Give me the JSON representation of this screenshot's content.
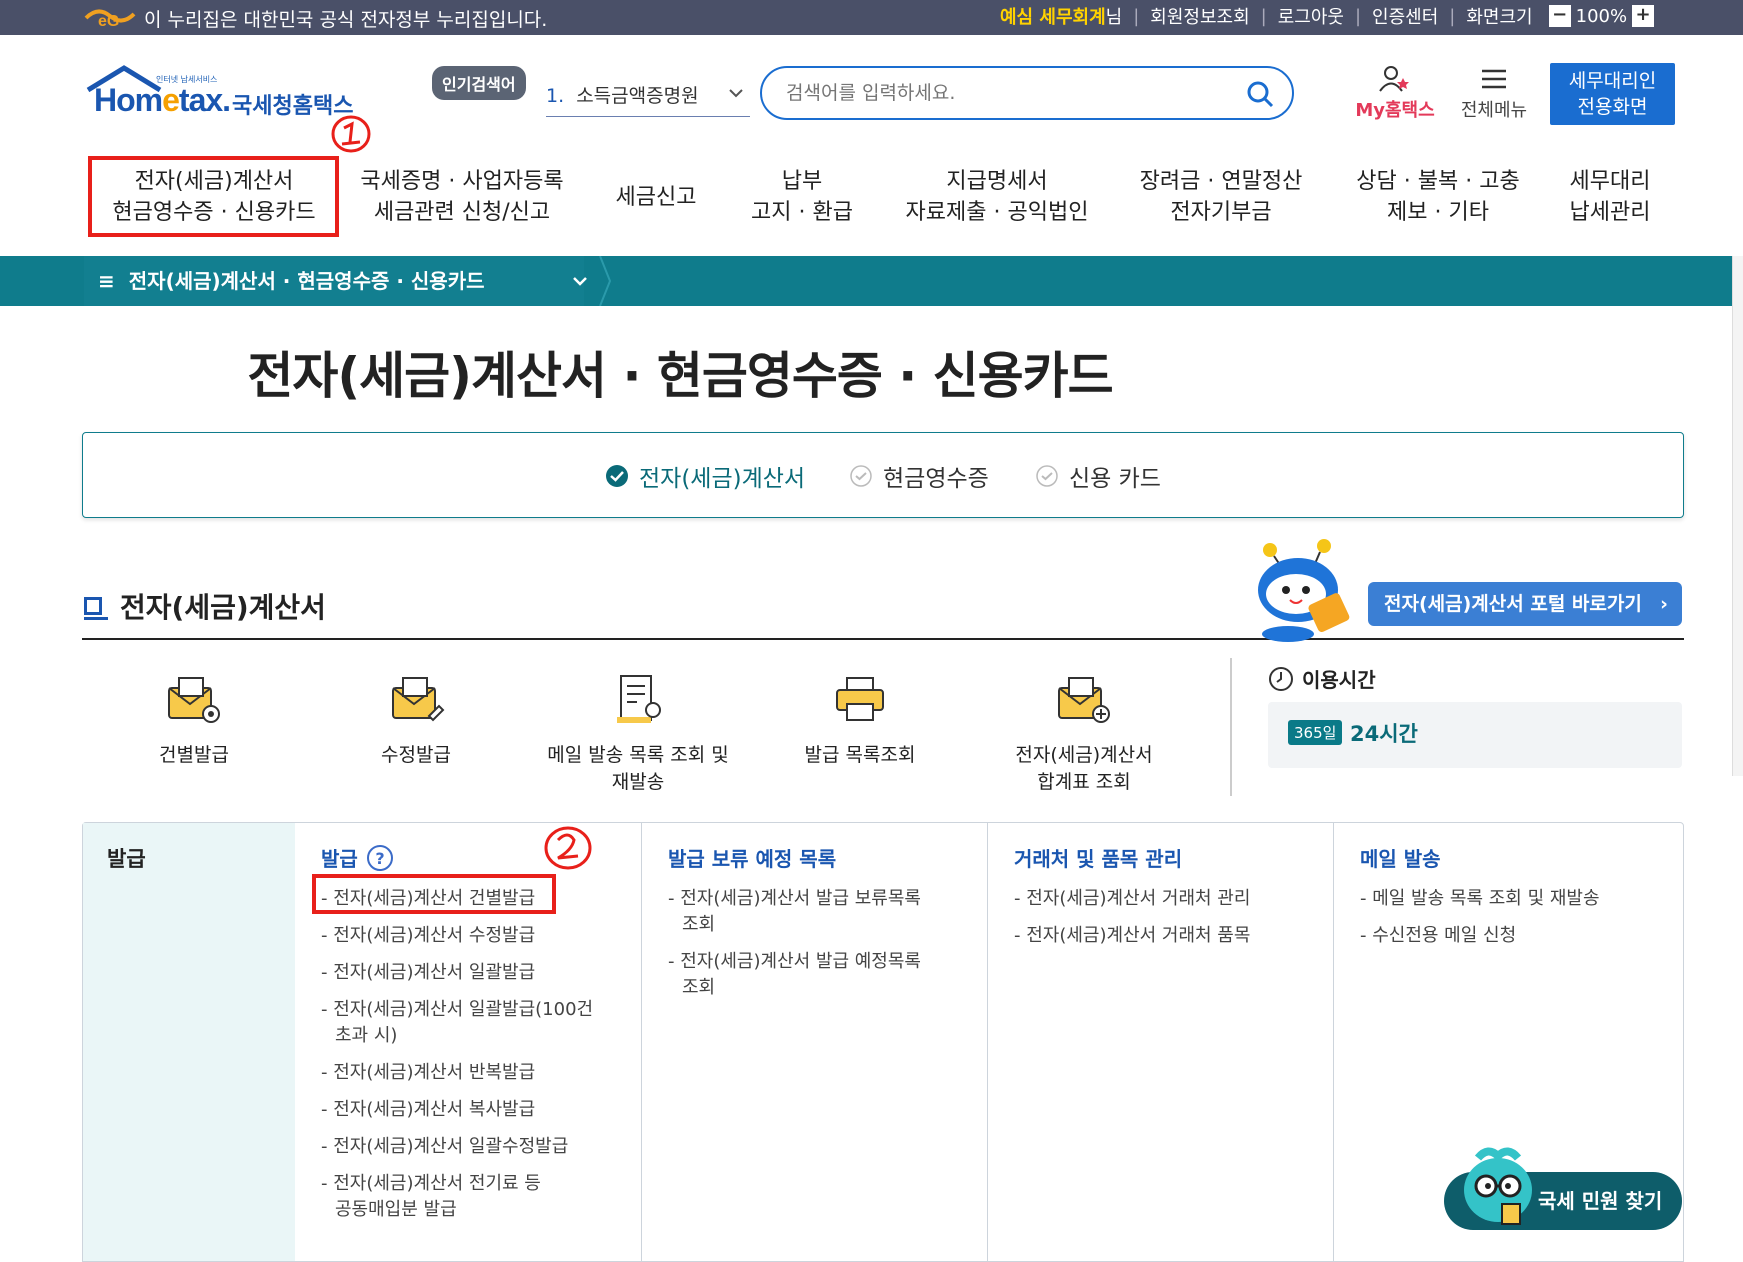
{
  "gov_bar": {
    "text": "이 누리집은 대한민국 공식 전자정부 누리집입니다.",
    "user_name": "예심 세무회계",
    "user_suffix": "님",
    "links": [
      "회원정보조회",
      "로그아웃",
      "인증센터",
      "화면크기"
    ],
    "zoom": "100%"
  },
  "header": {
    "logo_small": "인터넷 납세서비스",
    "logo_main_a": "Hom",
    "logo_main_e": "e",
    "logo_main_b": "tax.",
    "logo_kr": "국세청홈택스",
    "popular_tag": "인기검색어",
    "popular_rank": "1.",
    "popular_term": "소득금액증명원",
    "search_placeholder": "검색어를 입력하세요.",
    "my_hometax": "My홈택스",
    "all_menu": "전체메뉴",
    "agent_btn_line1": "세무대리인",
    "agent_btn_line2": "전용화면"
  },
  "gnb": [
    {
      "l1": "전자(세금)계산서",
      "l2": "현금영수증 · 신용카드"
    },
    {
      "l1": "국세증명 · 사업자등록",
      "l2": "세금관련 신청/신고"
    },
    {
      "l1": "세금신고",
      "l2": ""
    },
    {
      "l1": "납부",
      "l2": "고지 · 환급"
    },
    {
      "l1": "지급명세서",
      "l2": "자료제출 · 공익법인"
    },
    {
      "l1": "장려금 · 연말정산",
      "l2": "전자기부금"
    },
    {
      "l1": "상담 · 불복 · 고충",
      "l2": "제보 · 기타"
    },
    {
      "l1": "세무대리",
      "l2": "납세관리"
    }
  ],
  "breadcrumb": "전자(세금)계산서 · 현금영수증 · 신용카드",
  "page_title": "전자(세금)계산서 · 현금영수증 · 신용카드",
  "tabs": [
    "전자(세금)계산서",
    "현금영수증",
    "신용 카드"
  ],
  "section_title": "전자(세금)계산서",
  "portal_button": "전자(세금)계산서 포털 바로가기",
  "quick_menu": [
    {
      "l1": "건별발급",
      "l2": ""
    },
    {
      "l1": "수정발급",
      "l2": ""
    },
    {
      "l1": "메일 발송 목록 조회 및",
      "l2": "재발송"
    },
    {
      "l1": "발급 목록조회",
      "l2": ""
    },
    {
      "l1": "전자(세금)계산서",
      "l2": "합계표 조회"
    }
  ],
  "usage_time": {
    "label": "이용시간",
    "badge": "365일",
    "value": "24시간"
  },
  "menu": {
    "side": "발급",
    "columns": [
      {
        "title": "발급",
        "items": [
          "전자(세금)계산서 건별발급",
          "전자(세금)계산서 수정발급",
          "전자(세금)계산서 일괄발급",
          "전자(세금)계산서 일괄발급(100건 초과 시)",
          "전자(세금)계산서 반복발급",
          "전자(세금)계산서 복사발급",
          "전자(세금)계산서 일괄수정발급",
          "전자(세금)계산서 전기료 등 공동매입분 발급"
        ]
      },
      {
        "title": "발급 보류 예정 목록",
        "items": [
          "전자(세금)계산서 발급 보류목록 조회",
          "전자(세금)계산서 발급 예정목록 조회"
        ]
      },
      {
        "title": "거래처 및 품목 관리",
        "items": [
          "전자(세금)계산서 거래처 관리",
          "전자(세금)계산서 거래처 품목"
        ]
      },
      {
        "title": "메일 발송",
        "items": [
          "메일 발송 목록 조회 및 재발송",
          "수신전용 메일 신청"
        ]
      }
    ]
  },
  "fab": "국세 민원 찾기",
  "colors": {
    "teal": "#0f7c8c",
    "blue": "#1a56b0",
    "annotation_red": "#e8201a"
  }
}
